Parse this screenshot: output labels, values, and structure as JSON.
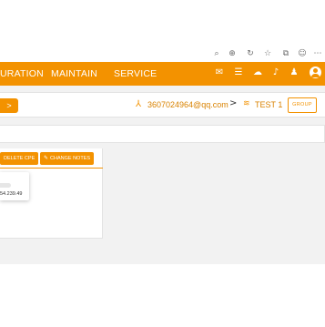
{
  "browser_toolbar": {
    "icons": [
      "read-aloud-icon",
      "zoom-icon",
      "refresh-icon",
      "favorite-icon",
      "collections-icon",
      "profile-icon",
      "more-icon"
    ]
  },
  "navbar": {
    "items": [
      "URATION",
      "MAINTAIN",
      "SERVICE"
    ],
    "right_icons": [
      "chat-icon",
      "list-icon",
      "cloud-icon",
      "bell-icon",
      "users-icon",
      "avatar-icon"
    ],
    "color": "#f39200"
  },
  "context_bar": {
    "back_label": ">",
    "account": "3607024964@qq.com",
    "separator": ">",
    "site": "TEST 1",
    "group_label": "GROUP"
  },
  "card": {
    "toolbar": {
      "delete_label": "DELETE CPE",
      "change_notes_label": "CHANGE NOTES"
    },
    "popup": {
      "ip_text": "54.239.49"
    }
  }
}
